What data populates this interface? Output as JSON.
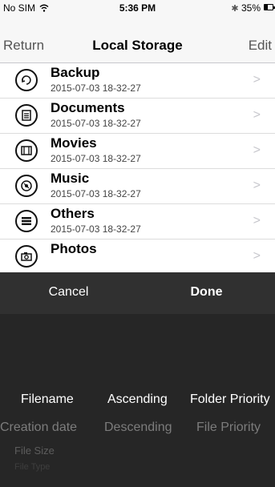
{
  "status": {
    "carrier": "No SIM",
    "time": "5:36 PM",
    "battery": "35%",
    "battery_level": 0.35
  },
  "nav": {
    "back_label": "Return",
    "title": "Local Storage",
    "edit_label": "Edit"
  },
  "items": [
    {
      "name": "Backup",
      "date": "2015-07-03 18-32-27",
      "icon": "backup-icon"
    },
    {
      "name": "Documents",
      "date": "2015-07-03 18-32-27",
      "icon": "documents-icon"
    },
    {
      "name": "Movies",
      "date": "2015-07-03 18-32-27",
      "icon": "film-icon"
    },
    {
      "name": "Music",
      "date": "2015-07-03 18-32-27",
      "icon": "disc-icon"
    },
    {
      "name": "Others",
      "date": "2015-07-03 18-32-27",
      "icon": "stack-icon"
    },
    {
      "name": "Photos",
      "date": "",
      "icon": "camera-icon"
    }
  ],
  "toolbar": {
    "cancel_label": "Cancel",
    "done_label": "Done"
  },
  "picker": {
    "sort_field": [
      "Filename",
      "Creation date",
      "File Size",
      "File Type"
    ],
    "order": [
      "Ascending",
      "Descending"
    ],
    "priority": [
      "Folder Priority",
      "File Priority"
    ]
  },
  "colors": {
    "bar_bg": "#f7f7f7",
    "sheet_bg": "#262626",
    "toolbar_bg": "#303030",
    "chevron": "#c7c7cc"
  }
}
